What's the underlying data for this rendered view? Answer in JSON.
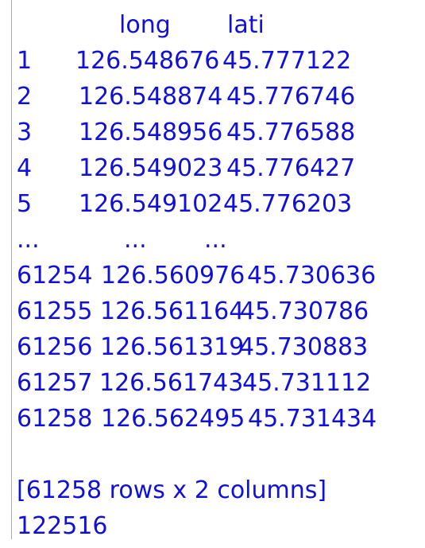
{
  "console": {
    "header": {
      "col_long": "long",
      "col_lati": "lati"
    },
    "rows_top": [
      {
        "index": "1",
        "long": "126.548676",
        "lati": "45.777122"
      },
      {
        "index": "2",
        "long": "126.548874",
        "lati": "45.776746"
      },
      {
        "index": "3",
        "long": "126.548956",
        "lati": "45.776588"
      },
      {
        "index": "4",
        "long": "126.549023",
        "lati": "45.776427"
      },
      {
        "index": "5",
        "long": "126.549102",
        "lati": "45.776203"
      }
    ],
    "ellipsis": {
      "index": "...",
      "long": "...",
      "lati": "..."
    },
    "rows_bottom": [
      {
        "index": "61254",
        "long": "126.560976",
        "lati": "45.730636"
      },
      {
        "index": "61255",
        "long": "126.561164",
        "lati": "45.730786"
      },
      {
        "index": "61256",
        "long": "126.561319",
        "lati": "45.730883"
      },
      {
        "index": "61257",
        "long": "126.561743",
        "lati": "45.731112"
      },
      {
        "index": "61258",
        "long": "126.562495",
        "lati": "45.731434"
      }
    ],
    "summary": "[61258 rows x 2 columns]",
    "result": "122516",
    "text_color": "#1010d8"
  }
}
